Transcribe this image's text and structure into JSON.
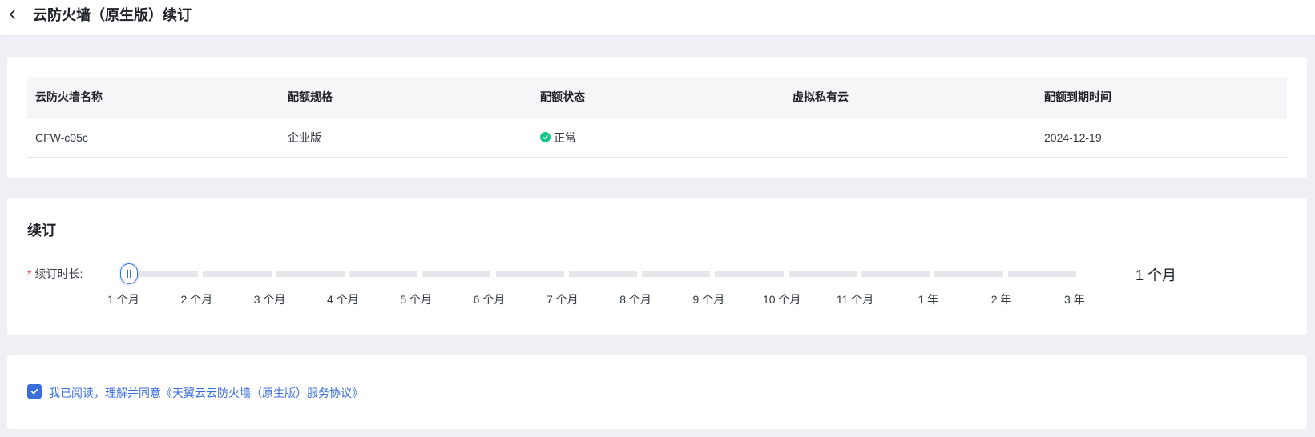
{
  "header": {
    "title": "云防火墙（原生版）续订"
  },
  "table": {
    "columns": [
      "云防火墙名称",
      "配额规格",
      "配额状态",
      "虚拟私有云",
      "配额到期时间"
    ],
    "rows": [
      {
        "name": "CFW-c05c",
        "spec": "企业版",
        "status": "正常",
        "vpc": "",
        "expire": "2024-12-19"
      }
    ]
  },
  "renew": {
    "title": "续订",
    "duration_label": "续订时长:",
    "options": [
      "1 个月",
      "2 个月",
      "3 个月",
      "4 个月",
      "5 个月",
      "6 个月",
      "7 个月",
      "8 个月",
      "9 个月",
      "10 个月",
      "11 个月",
      "1 年",
      "2 年",
      "3 年"
    ],
    "selected": "1 个月",
    "selected_index": 0
  },
  "agreement": {
    "checked": true,
    "text": "我已阅读，理解并同意《天翼云云防火墙（原生版）服务协议》"
  },
  "colors": {
    "accent": "#3b6fd8",
    "status_ok": "#16c784",
    "required": "#f53f3f"
  }
}
